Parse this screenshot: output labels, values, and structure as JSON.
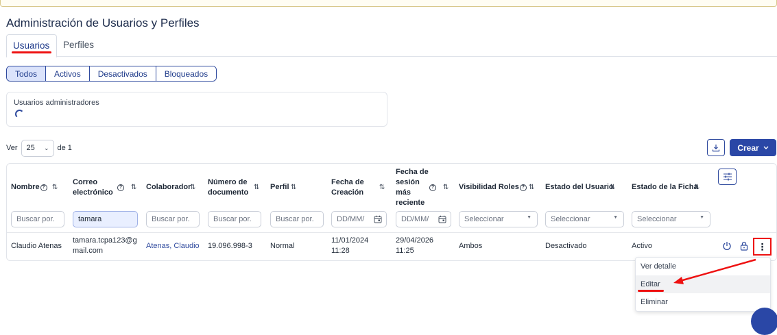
{
  "page": {
    "title": "Administración de Usuarios y Perfiles"
  },
  "tabs": [
    {
      "label": "Usuarios",
      "active": true
    },
    {
      "label": "Perfiles",
      "active": false
    }
  ],
  "status_filters": [
    {
      "label": "Todos",
      "active": true
    },
    {
      "label": "Activos",
      "active": false
    },
    {
      "label": "Desactivados",
      "active": false
    },
    {
      "label": "Bloqueados",
      "active": false
    }
  ],
  "admins_card": {
    "label": "Usuarios administradores"
  },
  "pagination": {
    "prefix": "Ver",
    "page_size": "25",
    "suffix": "de 1"
  },
  "actions": {
    "create_label": "Crear"
  },
  "table": {
    "columns": {
      "nombre": "Nombre",
      "correo_1": "Correo",
      "correo_2": "electrónico",
      "colaborador": "Colaborador",
      "documento_1": "Número de",
      "documento_2": "documento",
      "perfil": "Perfil",
      "creacion_1": "Fecha de",
      "creacion_2": "Creación",
      "sesion_1": "Fecha de",
      "sesion_2": "sesión",
      "sesion_3": "más",
      "sesion_4": "reciente",
      "visibilidad": "Visibilidad Roles",
      "estado_usuario": "Estado del Usuario",
      "estado_ficha": "Estado de la Ficha"
    },
    "filters": {
      "nombre": {
        "placeholder": "Buscar por.",
        "value": ""
      },
      "correo": {
        "placeholder": "Buscar por.",
        "value": "tamara"
      },
      "colaborador": {
        "placeholder": "Buscar por.",
        "value": ""
      },
      "documento": {
        "placeholder": "Buscar por.",
        "value": ""
      },
      "perfil": {
        "placeholder": "Buscar por.",
        "value": ""
      },
      "creacion": {
        "placeholder": "DD/MM/"
      },
      "sesion": {
        "placeholder": "DD/MM/"
      },
      "visibilidad": {
        "placeholder": "Seleccionar"
      },
      "estado_usuario": {
        "placeholder": "Seleccionar"
      },
      "estado_ficha": {
        "placeholder": "Seleccionar"
      }
    },
    "rows": [
      {
        "nombre": "Claudio Atenas",
        "correo_1": "tamara.tcpa123@g",
        "correo_2": "mail.com",
        "colaborador": "Atenas, Claudio",
        "documento": "19.096.998-3",
        "perfil": "Normal",
        "creacion_fecha": "11/01/2024",
        "creacion_hora": "11:28",
        "sesion_fecha": "29/04/2026",
        "sesion_hora": "11:25",
        "visibilidad": "Ambos",
        "estado_usuario": "Desactivado",
        "estado_ficha": "Activo"
      }
    ]
  },
  "row_menu": {
    "items": [
      "Ver detalle",
      "Editar",
      "Eliminar"
    ],
    "hovered": "Editar"
  },
  "colors": {
    "primary": "#2a47a6",
    "annotation": "#ee1111",
    "filter_active_bg": "#dbe3fb"
  },
  "icons": [
    "download-icon",
    "chevron-down-icon",
    "column-settings-icon",
    "power-icon",
    "lock-icon",
    "kebab-menu-icon",
    "calendar-icon",
    "sort-icon",
    "help-icon"
  ]
}
